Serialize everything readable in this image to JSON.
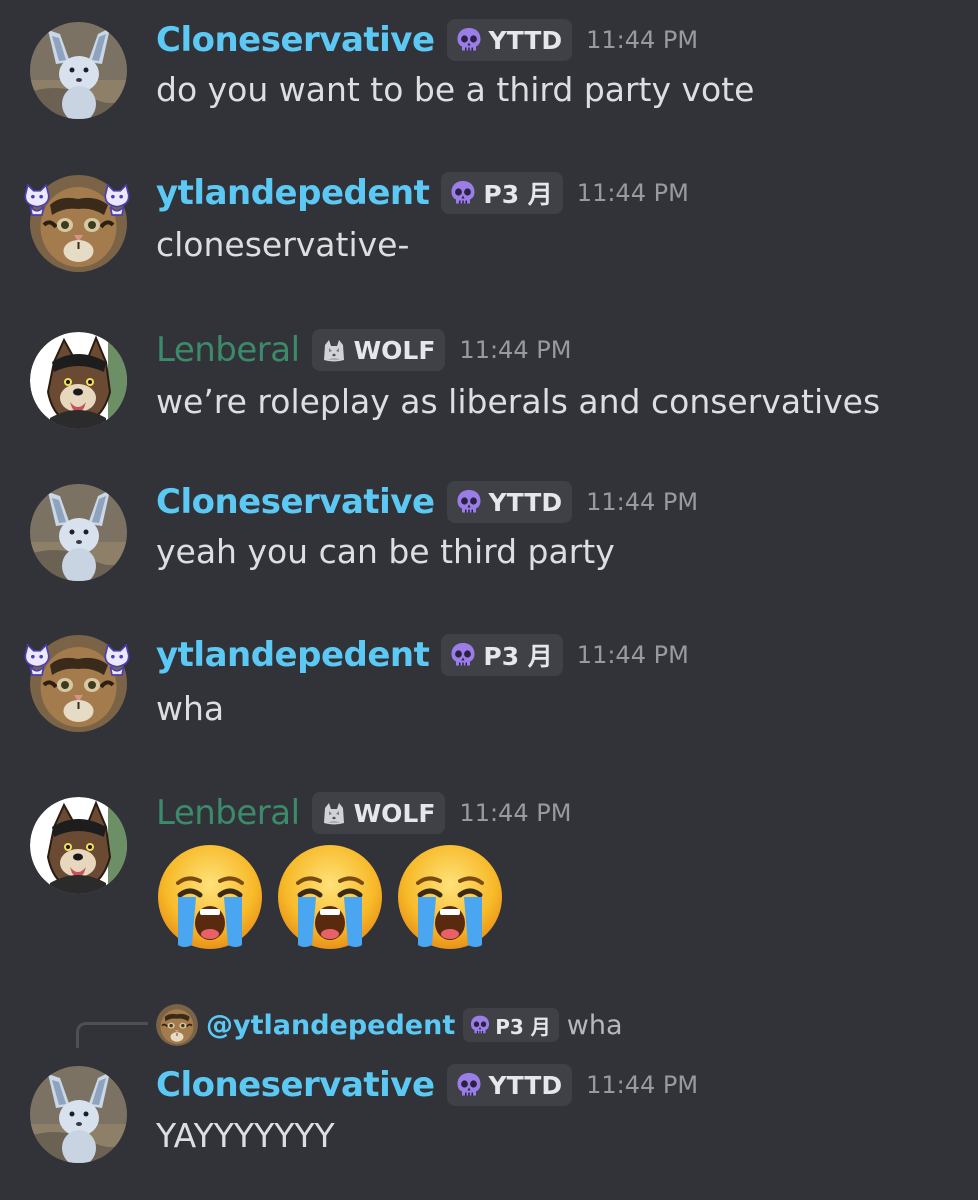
{
  "colors": {
    "background": "#313338",
    "clone_name": "#5cc9f5",
    "yt_name": "#5cc9f5",
    "len_name": "#3d8a6b",
    "tag_bg": "#3f4147",
    "timestamp": "#979ba1",
    "message_text": "#dcdee1"
  },
  "messages": [
    {
      "author": "Cloneservative",
      "tag_icon": "skull-icon",
      "tag": "YTTD",
      "time": "11:44 PM",
      "text": "do you want to be a third party vote"
    },
    {
      "author": "ytlandepedent",
      "tag_icon": "skull-icon",
      "tag": "P3 月",
      "time": "11:44 PM",
      "text": "cloneservative-"
    },
    {
      "author": "Lenberal",
      "tag_icon": "wolf-icon",
      "tag": "WOLF",
      "time": "11:44 PM",
      "text": "we’re roleplay as liberals and conservatives"
    },
    {
      "author": "Cloneservative",
      "tag_icon": "skull-icon",
      "tag": "YTTD",
      "time": "11:44 PM",
      "text": "yeah you can be third party"
    },
    {
      "author": "ytlandepedent",
      "tag_icon": "skull-icon",
      "tag": "P3 月",
      "time": "11:44 PM",
      "text": "wha"
    },
    {
      "author": "Lenberal",
      "tag_icon": "wolf-icon",
      "tag": "WOLF",
      "time": "11:44 PM",
      "emoji": [
        "loudly-crying-face",
        "loudly-crying-face",
        "loudly-crying-face"
      ]
    },
    {
      "author": "Cloneservative",
      "tag_icon": "skull-icon",
      "tag": "YTTD",
      "time": "11:44 PM",
      "text": "YAYYYYYYY"
    }
  ],
  "reply": {
    "mention": "@ytlandepedent",
    "tag_icon": "skull-icon",
    "tag": "P3 月",
    "text": "wha"
  }
}
